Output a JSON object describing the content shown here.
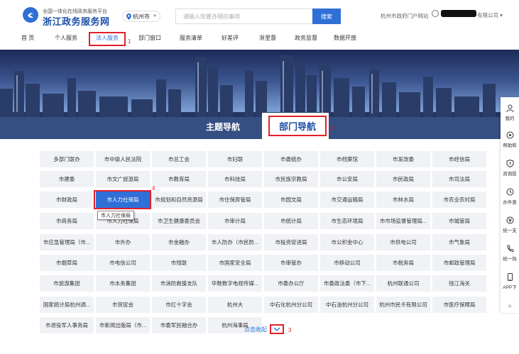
{
  "header": {
    "site_subtitle": "全国一体化在线政务服务平台",
    "site_title": "浙江政务服务网",
    "city": "杭州市",
    "search_placeholder": "请输入您要办理的事项",
    "search_button": "搜索",
    "portal_link": "杭州市政府门户网站",
    "user_suffix": "有限公司"
  },
  "nav": {
    "items": [
      "首 页",
      "个人服务",
      "法人服务",
      "部门窗口",
      "服务清单",
      "好差评",
      "浙里督",
      "政务监督",
      "数据开放"
    ],
    "active_index": 2
  },
  "banner": {
    "tab_theme": "主题导航",
    "tab_dept": "部门导航"
  },
  "annotations": [
    "1",
    "2",
    "3",
    "4"
  ],
  "departments": [
    [
      "多部门联办",
      "市中级人民法院",
      "市总工会",
      "市妇联",
      "市委统办",
      "市档案馆",
      "市发改委",
      "市经信局"
    ],
    [
      "市建委",
      "市文广旅游局",
      "市教育局",
      "市科技局",
      "市民族宗教局",
      "市公安局",
      "市民政局",
      "市司法局"
    ],
    [
      "市财政局",
      "市人力社保局",
      "市规划和自然资源局",
      "市住保房管局",
      "市园文局",
      "市交通运输局",
      "市林水局",
      "市农业农村局"
    ],
    [
      "市商务局",
      "市人力社保局",
      "市卫生健康委员会",
      "市审计局",
      "市统计局",
      "市生态环境局",
      "市市场监督管理局...",
      "市城管局"
    ],
    [
      "市应急管理局（市...",
      "市外办",
      "市金融办",
      "市人防办（市民防...",
      "市投资促进局",
      "市公积金中心",
      "市供电公司",
      "市气象局"
    ],
    [
      "市烟草局",
      "市电信公司",
      "市残联",
      "市国家安全局",
      "市审管办",
      "市移动公司",
      "市税务局",
      "市邮政管理局"
    ],
    [
      "市旅游集团",
      "市水务集团",
      "市消防救援支队",
      "华数数字电视传媒...",
      "市委办公厅",
      "市委政法委（市下...",
      "杭州联通公司",
      "钱江海关"
    ],
    [
      "国家统计局杭州调...",
      "市贸促会",
      "市红十字会",
      "杭州大",
      "中石化杭州分公司",
      "中石油杭州分公司",
      "杭州市民卡有限公司",
      "市医疗保障局"
    ],
    [
      "市退役军人事务局",
      "市新闻出版局（市...",
      "市委军民融合办",
      "杭州海事局"
    ]
  ],
  "highlighted": {
    "row": 2,
    "col": 1
  },
  "tooltip": "市人力社保局",
  "collapse_label": "点击收起",
  "dock": [
    "我的",
    "帮助和",
    "咨询投",
    "办件查",
    "统一支",
    "统一热",
    "APP下"
  ],
  "colors": {
    "accent": "#2f6fd6",
    "annotation": "#e0202a"
  }
}
